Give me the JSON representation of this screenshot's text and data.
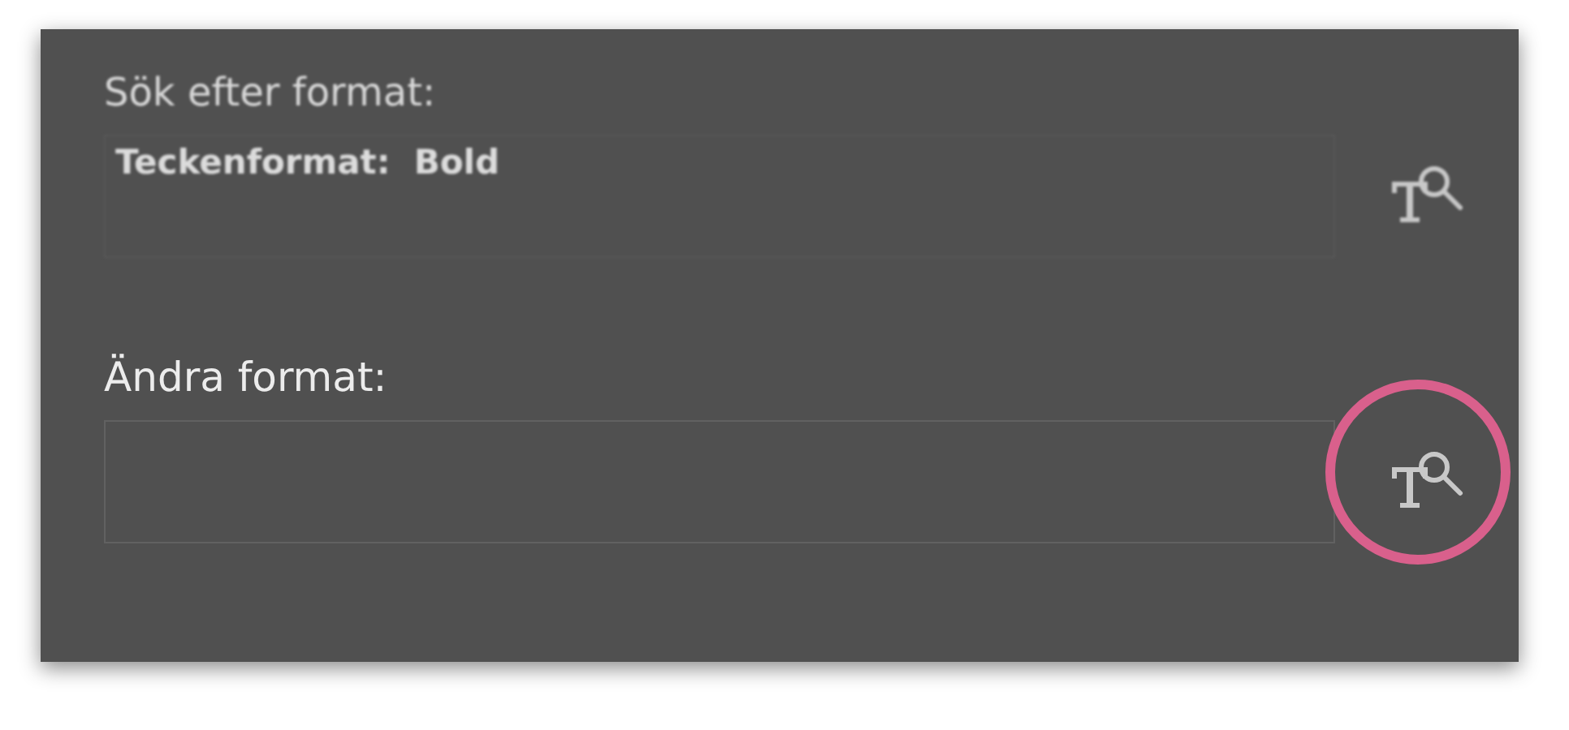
{
  "sections": [
    {
      "label": "Sök efter format:",
      "value": "Teckenformat:  Bold",
      "blurred": true,
      "highlighted": false
    },
    {
      "label": "Ändra format:",
      "blurred": false,
      "highlighted": true
    }
  ]
}
